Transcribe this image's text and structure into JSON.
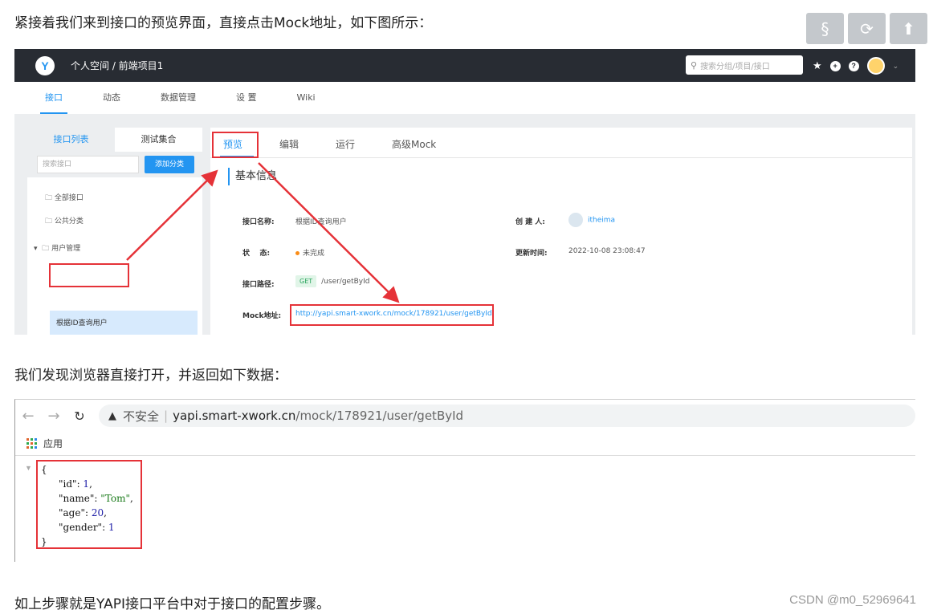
{
  "article": {
    "para1": "紧接着我们来到接口的预览界面，直接点击Mock地址，如下图所示：",
    "para2": "我们发现浏览器直接打开，并返回如下数据：",
    "para3": "如上步骤就是YAPI接口平台中对于接口的配置步骤。",
    "watermark": "CSDN @m0_52969641"
  },
  "float_buttons": [
    "§",
    "⟳",
    "⬆"
  ],
  "yapi": {
    "logo": "Y",
    "breadcrumb": "个人空间 / 前端项目1",
    "search_placeholder": "搜索分组/项目/接口",
    "nav_tabs": [
      "接口",
      "动态",
      "数据管理",
      "设 置",
      "Wiki"
    ],
    "sidebar_tabs": [
      "接口列表",
      "测试集合"
    ],
    "sidebar_search_placeholder": "搜索接口",
    "add_category_button": "添加分类",
    "tree": [
      "全部接口",
      "公共分类",
      "用户管理",
      "根据ID查询用户"
    ],
    "main_tabs": [
      "预览",
      "编辑",
      "运行",
      "高级Mock"
    ],
    "section_title": "基本信息",
    "fields": {
      "name_label": "接口名称:",
      "name_value": "根据ID查询用户",
      "creator_label": "创 建 人:",
      "creator_value": "itheima",
      "status_label": "状    态:",
      "status_value": "未完成",
      "updated_label": "更新时间:",
      "updated_value": "2022-10-08 23:08:47",
      "path_label": "接口路径:",
      "method": "GET",
      "path_value": "/user/getById",
      "mock_label": "Mock地址:",
      "mock_url": "http://yapi.smart-xwork.cn/mock/178921/user/getById"
    },
    "accent_color": "#2395f1",
    "header_color": "#282c33",
    "highlight_color": "#e53238"
  },
  "browser": {
    "insecure_label": "不安全",
    "separator": "|",
    "domain": "yapi.smart-xwork.cn",
    "path": "/mock/178921/user/getById",
    "apps_label": "应用",
    "json": {
      "open_brace": "{",
      "close_brace": "}",
      "lines": [
        {
          "key": "\"id\"",
          "value": "1",
          "type": "num",
          "comma": ","
        },
        {
          "key": "\"name\"",
          "value": "\"Tom\"",
          "type": "str",
          "comma": ","
        },
        {
          "key": "\"age\"",
          "value": "20",
          "type": "num",
          "comma": ","
        },
        {
          "key": "\"gender\"",
          "value": "1",
          "type": "num",
          "comma": ""
        }
      ]
    }
  }
}
